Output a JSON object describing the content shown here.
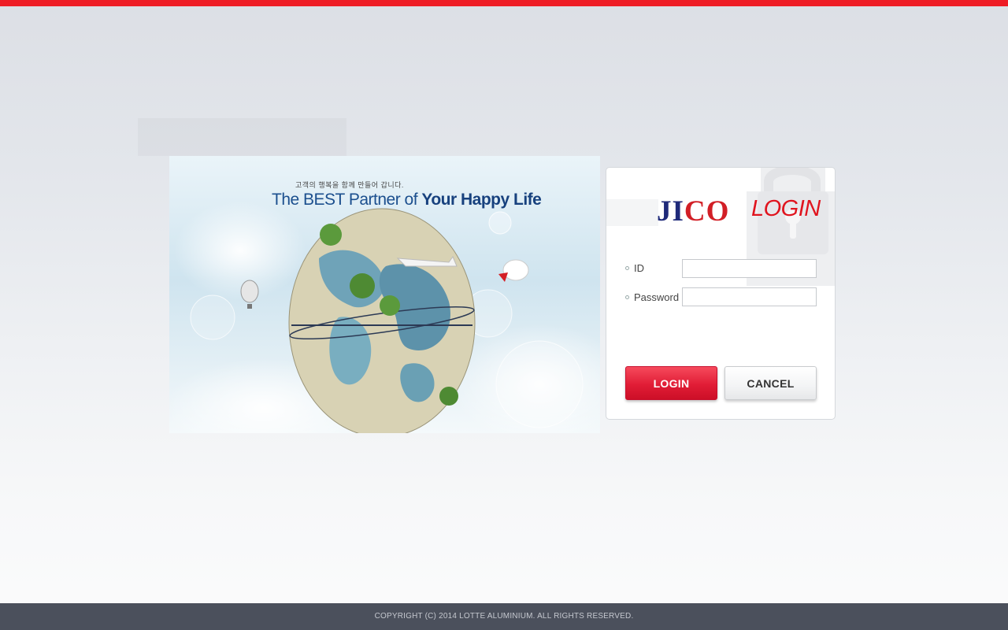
{
  "colors": {
    "accent_red": "#ee1c25",
    "logo_navy": "#1f2a7a",
    "footer_bg": "#4b505c"
  },
  "hero": {
    "subtitle": "고객의 행복을 함께 만들어 갑니다.",
    "title_part1": "The BEST Partner of ",
    "title_part2": "Your Happy Life",
    "image_desc_icon": "globe-illustration"
  },
  "login": {
    "logo_part1": "JI",
    "logo_part2": "CO",
    "login_word": "LOGIN",
    "id_label": "ID",
    "id_value": "",
    "password_label": "Password",
    "password_value": "",
    "login_button": "LOGIN",
    "cancel_button": "CANCEL",
    "lock_icon": "lock-icon"
  },
  "footer": {
    "copyright": "COPYRIGHT (C) 2014 LOTTE ALUMINIUM. ALL RIGHTS RESERVED."
  }
}
